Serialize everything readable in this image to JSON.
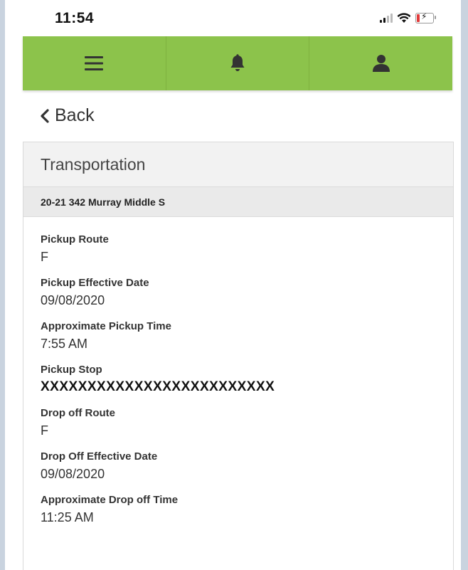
{
  "status_bar": {
    "time": "11:54",
    "icons": [
      "signal-icon",
      "wifi-icon",
      "battery-charging-icon"
    ]
  },
  "nav_bar": {
    "items": [
      {
        "icon": "hamburger-menu-icon"
      },
      {
        "icon": "bell-icon"
      },
      {
        "icon": "user-icon"
      }
    ],
    "color": "#8cc34b"
  },
  "back": {
    "label": "Back",
    "icon": "chevron-left-icon"
  },
  "card": {
    "title": "Transportation",
    "subtitle": "20-21 342 Murray Middle S",
    "fields": [
      {
        "label": "Pickup Route",
        "value": "F"
      },
      {
        "label": "Pickup Effective Date",
        "value": "09/08/2020"
      },
      {
        "label": "Approximate Pickup Time",
        "value": "7:55 AM"
      },
      {
        "label": "Pickup Stop",
        "value": "XXXXXXXXXXXXXXXXXXXXXXXXX"
      },
      {
        "label": "Drop off Route",
        "value": "F"
      },
      {
        "label": "Drop Off Effective Date",
        "value": "09/08/2020"
      },
      {
        "label": "Approximate Drop off Time",
        "value": "11:25 AM"
      }
    ]
  }
}
